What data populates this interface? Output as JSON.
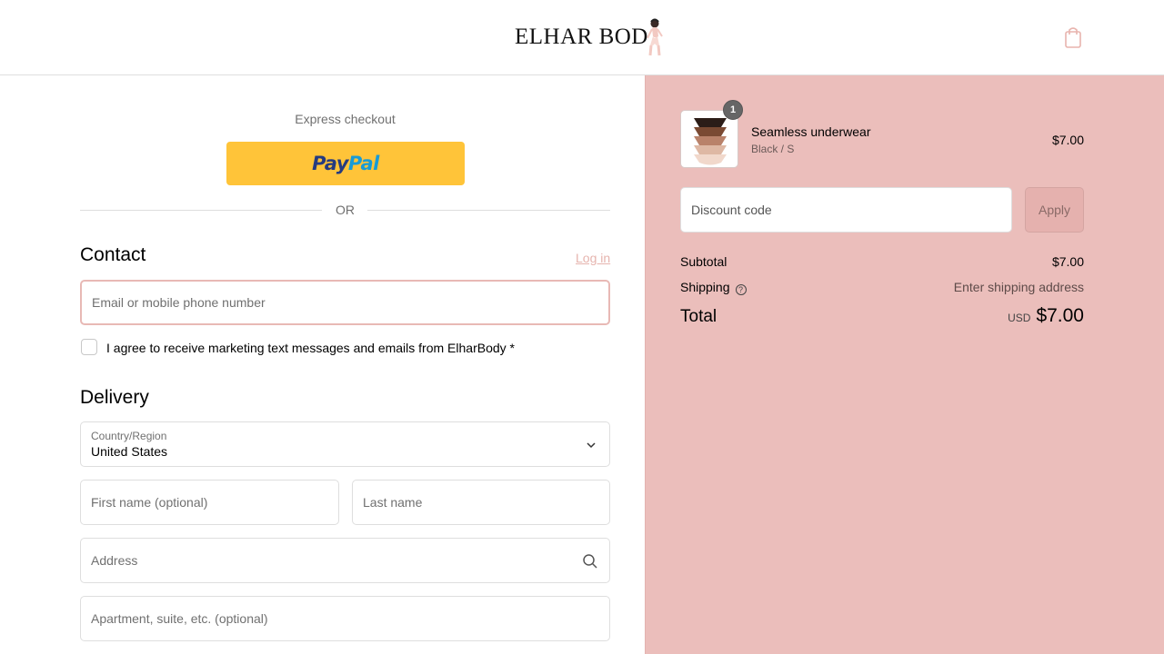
{
  "header": {
    "logo_text": "ELHAR BOD",
    "logo_icon": "woman-figure-logo",
    "cart_icon": "shopping-bag-icon"
  },
  "express": {
    "label": "Express checkout",
    "paypal_pay": "Pay",
    "paypal_pal": "Pal",
    "or_text": "OR"
  },
  "contact": {
    "heading": "Contact",
    "login_label": "Log in",
    "email_placeholder": "Email or mobile phone number",
    "marketing_label": "I agree to receive marketing text messages and emails from ElharBody *"
  },
  "delivery": {
    "heading": "Delivery",
    "country_label": "Country/Region",
    "country_value": "United States",
    "first_name_placeholder": "First name (optional)",
    "last_name_placeholder": "Last name",
    "address_placeholder": "Address",
    "apartment_placeholder": "Apartment, suite, etc. (optional)"
  },
  "order": {
    "item": {
      "quantity": "1",
      "name": "Seamless underwear",
      "variant": "Black / S",
      "price": "$7.00"
    },
    "discount_placeholder": "Discount code",
    "apply_label": "Apply",
    "subtotal_label": "Subtotal",
    "subtotal_value": "$7.00",
    "shipping_label": "Shipping",
    "shipping_value": "Enter shipping address",
    "total_label": "Total",
    "total_currency": "USD",
    "total_value": "$7.00"
  },
  "colors": {
    "summary_bg": "#ebbebb",
    "paypal_yellow": "#ffc439",
    "accent_pink": "#e6b4ae"
  }
}
